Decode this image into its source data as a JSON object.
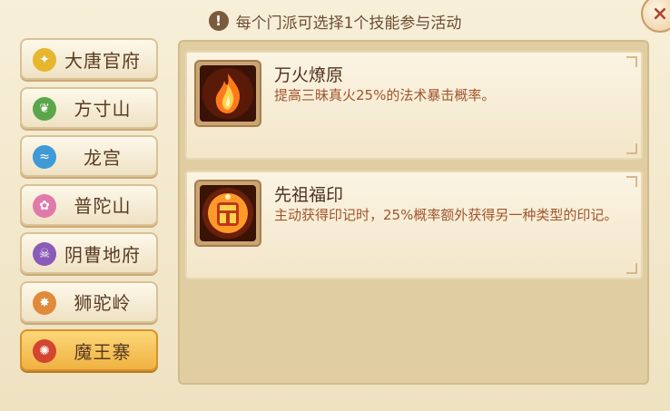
{
  "notice": {
    "icon": "exclamation-icon",
    "text": "每个门派可选择1个技能参与活动"
  },
  "close": {
    "icon": "close-icon",
    "label": "×"
  },
  "schools": [
    {
      "label": "大唐官府",
      "icon": "sword-emblem-icon",
      "color": "#e6b62f",
      "active": false
    },
    {
      "label": "方寸山",
      "icon": "leaf-emblem-icon",
      "color": "#5ba64a",
      "active": false
    },
    {
      "label": "龙宫",
      "icon": "water-emblem-icon",
      "color": "#3f9ad6",
      "active": false
    },
    {
      "label": "普陀山",
      "icon": "lotus-emblem-icon",
      "color": "#e07aa8",
      "active": false
    },
    {
      "label": "阴曹地府",
      "icon": "skull-emblem-icon",
      "color": "#8a5bb8",
      "active": false
    },
    {
      "label": "狮驼岭",
      "icon": "beast-emblem-icon",
      "color": "#e08a3a",
      "active": false
    },
    {
      "label": "魔王寨",
      "icon": "demon-emblem-icon",
      "color": "#d2452f",
      "active": true
    }
  ],
  "skills": [
    {
      "name": "万火燎原",
      "desc": "提高三昧真火25%的法术暴击概率。",
      "icon": "fire-orb-icon"
    },
    {
      "name": "先祖福印",
      "desc": "主动获得印记时，25%概率额外获得另一种类型的印记。",
      "icon": "flame-seal-icon"
    }
  ]
}
